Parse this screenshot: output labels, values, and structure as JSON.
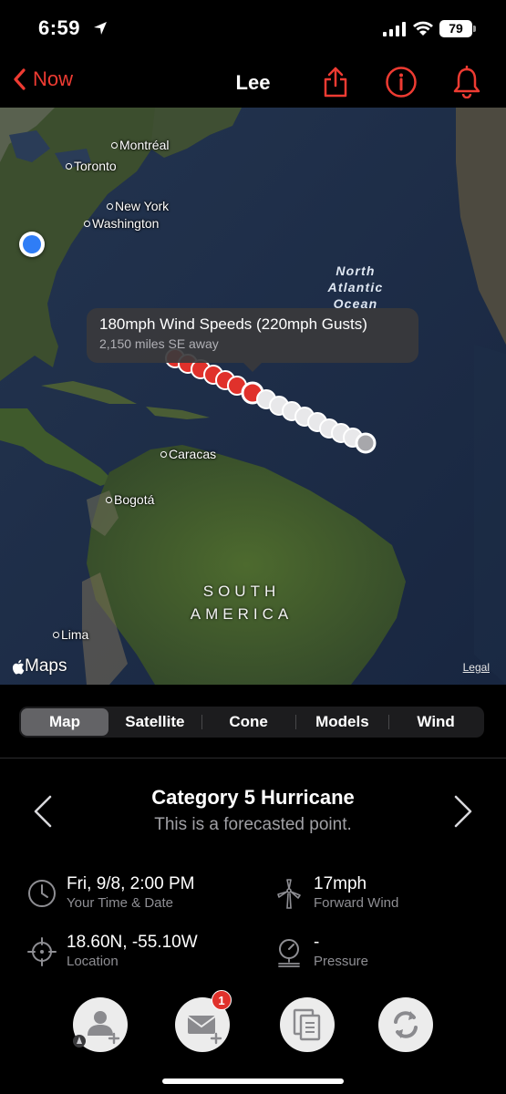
{
  "status_bar": {
    "time": "6:59",
    "battery": "79"
  },
  "nav": {
    "back_label": "Now",
    "title": "Lee"
  },
  "map": {
    "cities": [
      "Montréal",
      "Toronto",
      "New York",
      "Washington",
      "Caracas",
      "Bogotá",
      "Lima"
    ],
    "ocean_label": [
      "North",
      "Atlantic",
      "Ocean"
    ],
    "continent_label": [
      "SOUTH",
      "AMERICA"
    ],
    "callout": {
      "title": "180mph Wind Speeds (220mph Gusts)",
      "subtitle": "2,150 miles SE away"
    },
    "brand": "Maps",
    "legal": "Legal"
  },
  "tabs": [
    {
      "label": "Map",
      "active": true
    },
    {
      "label": "Satellite",
      "active": false
    },
    {
      "label": "Cone",
      "active": false
    },
    {
      "label": "Models",
      "active": false
    },
    {
      "label": "Wind",
      "active": false
    }
  ],
  "point": {
    "category": "Category 5 Hurricane",
    "description": "This is a forecasted point."
  },
  "details": {
    "time": {
      "value": "Fri, 9/8, 2:00 PM",
      "label": "Your Time & Date",
      "icon": "clock-icon"
    },
    "forward_wind": {
      "value": "17mph",
      "label": "Forward Wind",
      "icon": "wind-turbine-icon"
    },
    "location": {
      "value": "18.60N, -55.10W",
      "label": "Location",
      "icon": "crosshair-icon"
    },
    "pressure": {
      "value": "-",
      "label": "Pressure",
      "icon": "barometer-icon"
    }
  },
  "actions": {
    "mail_badge": "1"
  },
  "colors": {
    "accent": "#ee3b32",
    "track_active": "#e0312b",
    "track_inactive": "#e8e8ea"
  }
}
